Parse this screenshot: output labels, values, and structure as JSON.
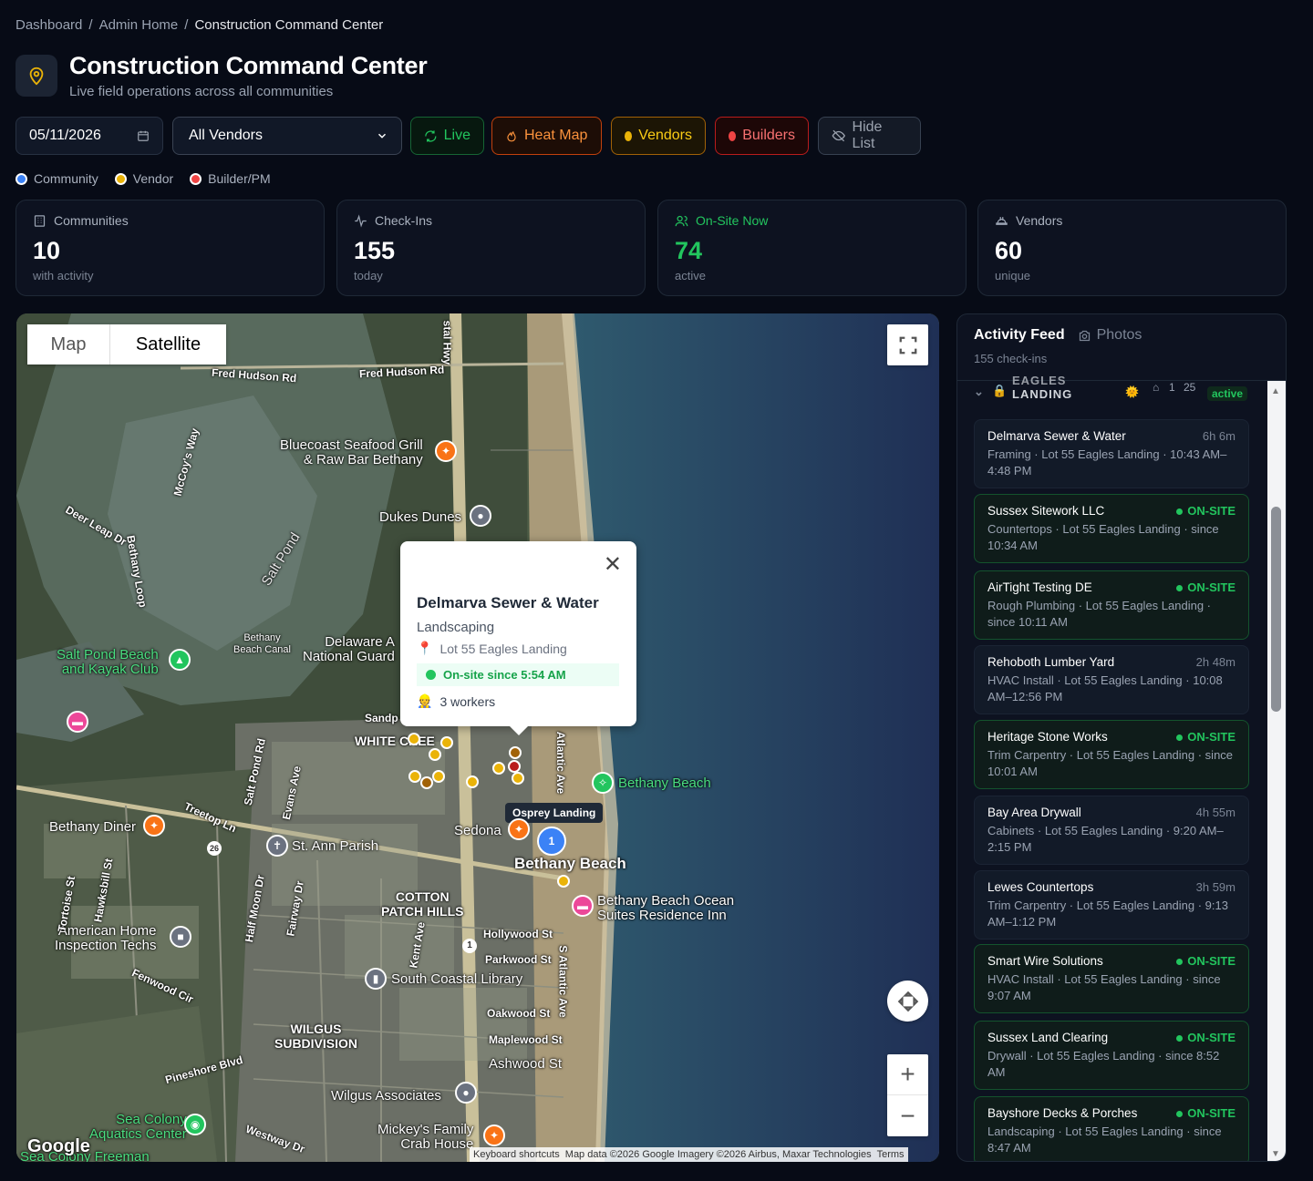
{
  "breadcrumb": {
    "items": [
      "Dashboard",
      "Admin Home"
    ],
    "current": "Construction Command Center",
    "sep": "/"
  },
  "header": {
    "title": "Construction Command Center",
    "subtitle": "Live field operations across all communities"
  },
  "controls": {
    "date": "05/11/2026",
    "vendor_filter": "All Vendors",
    "buttons": {
      "live": "Live",
      "heatmap": "Heat Map",
      "vendors": "Vendors",
      "builders": "Builders",
      "hide_list": "Hide List"
    }
  },
  "legend": [
    {
      "label": "Community",
      "color": "#3b82f6"
    },
    {
      "label": "Vendor",
      "color": "#eab308"
    },
    {
      "label": "Builder/PM",
      "color": "#ef4444"
    }
  ],
  "stats": [
    {
      "label": "Communities",
      "value": "10",
      "sub": "with activity",
      "icon": "building-icon"
    },
    {
      "label": "Check-Ins",
      "value": "155",
      "sub": "today",
      "icon": "activity-icon"
    },
    {
      "label": "On-Site Now",
      "value": "74",
      "sub": "active",
      "icon": "users-icon",
      "accent": "#22c55e"
    },
    {
      "label": "Vendors",
      "value": "60",
      "sub": "unique",
      "icon": "hardhat-icon"
    }
  ],
  "map": {
    "tabs": {
      "map": "Map",
      "satellite": "Satellite"
    },
    "labels": {
      "fred_hudson_1": "Fred Hudson Rd",
      "fred_hudson_2": "Fred Hudson Rd",
      "coastal_hwy": "stal Hwy",
      "bluecoast": "Bluecoast Seafood Grill\n& Raw Bar Bethany",
      "dukes": "Dukes Dunes",
      "salt_pond": "Salt Pond",
      "mccoys": "McCoy's Way",
      "deer": "Deer Leap Dr",
      "bethany_loop": "Bethany Loop",
      "bethany_canal": "Bethany\nBeach Canal",
      "delaware": "Delaware A\nNational Guard",
      "saltpond_beach": "Salt Pond Beach\nand Kayak Club",
      "white_creek": "WHITE CREE",
      "sandp": "Sandp",
      "atlantic_ave": "Atlantic Ave",
      "bethany_beach_pin": "Bethany Beach",
      "osprey": "Osprey Landing",
      "bethany_diner": "Bethany Diner",
      "treetop": "Treetop Ln",
      "saltpond_rd": "Salt Pond Rd",
      "evans": "Evans Ave",
      "st_ann": "St. Ann Parish",
      "sedona": "Sedona",
      "bethany_beach_town": "Bethany Beach",
      "cotton": "COTTON\nPATCH HILLS",
      "ocean_suites": "Bethany Beach Ocean\nSuites Residence Inn",
      "american_home": "American Home\nInspection Techs",
      "fenwood": "Fenwood Cir",
      "half_moon": "Half Moon Dr",
      "fairway": "Fairway Dr",
      "kent": "Kent Ave",
      "hollywood": "Hollywood St",
      "parkwood": "Parkwood St",
      "library": "South Coastal Library",
      "oakwood": "Oakwood St",
      "maplewood": "Maplewood St",
      "ashwood": "Ashwood St",
      "s_atlantic": "S Atlantic Ave",
      "wilgus": "WILGUS\nSUBDIVISION",
      "pineshore": "Pineshore Blvd",
      "wilgus_assoc": "Wilgus Associates",
      "sea_colony": "Sea Colony\nAquatics Center",
      "westway": "Westway Dr",
      "mickeys": "Mickey's Family\nCrab House",
      "sea_colony_freeman": "Sea Colony Freeman",
      "tortoise": "Tortoise St",
      "hawksbill": "Hawksbill St",
      "route_26": "26",
      "route_1": "1",
      "cluster": "1",
      "google": "Google"
    },
    "attribution": {
      "shortcuts": "Keyboard shortcuts",
      "data": "Map data ©2026 Google Imagery ©2026 Airbus, Maxar Technologies",
      "terms": "Terms"
    },
    "popup": {
      "name": "Delmarva Sewer & Water",
      "trade": "Landscaping",
      "lot": "Lot 55 Eagles Landing",
      "onsite": "On-site since 5:54 AM",
      "workers": "3 workers"
    }
  },
  "feed": {
    "title": "Activity Feed",
    "photos": "Photos",
    "count": "155 check-ins",
    "group": {
      "name_top": "EAGLES",
      "name": "LANDING",
      "a": "1",
      "b": "25",
      "active": "active"
    },
    "items": [
      {
        "name": "Delmarva Sewer & Water",
        "status": "6h 6m",
        "onsite": false,
        "detail": "Framing · Lot 55 Eagles Landing · 10:43 AM–4:48 PM"
      },
      {
        "name": "Sussex Sitework LLC",
        "status": "ON-SITE",
        "onsite": true,
        "detail": "Countertops · Lot 55 Eagles Landing · since 10:34 AM"
      },
      {
        "name": "AirTight Testing DE",
        "status": "ON-SITE",
        "onsite": true,
        "detail": "Rough Plumbing · Lot 55 Eagles Landing · since 10:11 AM"
      },
      {
        "name": "Rehoboth Lumber Yard",
        "status": "2h 48m",
        "onsite": false,
        "detail": "HVAC Install · Lot 55 Eagles Landing · 10:08 AM–12:56 PM"
      },
      {
        "name": "Heritage Stone Works",
        "status": "ON-SITE",
        "onsite": true,
        "detail": "Trim Carpentry · Lot 55 Eagles Landing · since 10:01 AM"
      },
      {
        "name": "Bay Area Drywall",
        "status": "4h 55m",
        "onsite": false,
        "detail": "Cabinets · Lot 55 Eagles Landing · 9:20 AM–2:15 PM"
      },
      {
        "name": "Lewes Countertops",
        "status": "3h 59m",
        "onsite": false,
        "detail": "Trim Carpentry · Lot 55 Eagles Landing · 9:13 AM–1:12 PM"
      },
      {
        "name": "Smart Wire Solutions",
        "status": "ON-SITE",
        "onsite": true,
        "detail": "HVAC Install · Lot 55 Eagles Landing · since 9:07 AM"
      },
      {
        "name": "Sussex Land Clearing",
        "status": "ON-SITE",
        "onsite": true,
        "detail": "Drywall · Lot 55 Eagles Landing · since 8:52 AM"
      },
      {
        "name": "Bayshore Decks & Porches",
        "status": "ON-SITE",
        "onsite": true,
        "detail": "Landscaping · Lot 55 Eagles Landing · since 8:47 AM"
      }
    ]
  }
}
